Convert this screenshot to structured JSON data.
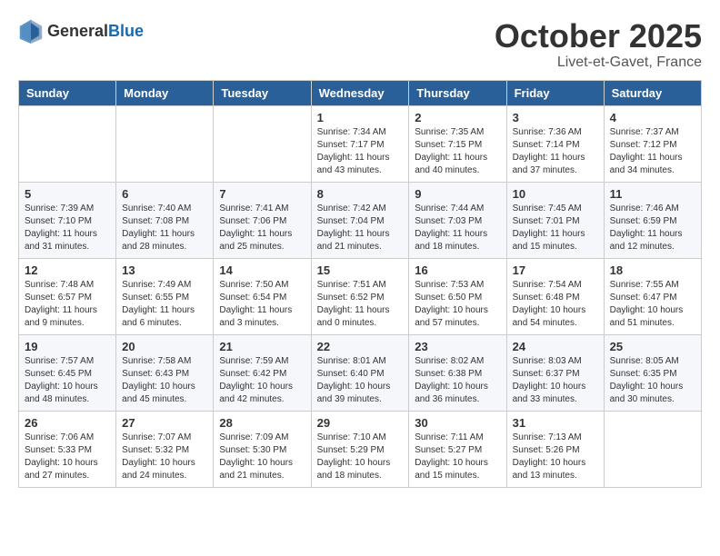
{
  "header": {
    "logo_general": "General",
    "logo_blue": "Blue",
    "title": "October 2025",
    "subtitle": "Livet-et-Gavet, France"
  },
  "weekdays": [
    "Sunday",
    "Monday",
    "Tuesday",
    "Wednesday",
    "Thursday",
    "Friday",
    "Saturday"
  ],
  "weeks": [
    [
      {
        "day": "",
        "info": ""
      },
      {
        "day": "",
        "info": ""
      },
      {
        "day": "",
        "info": ""
      },
      {
        "day": "1",
        "info": "Sunrise: 7:34 AM\nSunset: 7:17 PM\nDaylight: 11 hours\nand 43 minutes."
      },
      {
        "day": "2",
        "info": "Sunrise: 7:35 AM\nSunset: 7:15 PM\nDaylight: 11 hours\nand 40 minutes."
      },
      {
        "day": "3",
        "info": "Sunrise: 7:36 AM\nSunset: 7:14 PM\nDaylight: 11 hours\nand 37 minutes."
      },
      {
        "day": "4",
        "info": "Sunrise: 7:37 AM\nSunset: 7:12 PM\nDaylight: 11 hours\nand 34 minutes."
      }
    ],
    [
      {
        "day": "5",
        "info": "Sunrise: 7:39 AM\nSunset: 7:10 PM\nDaylight: 11 hours\nand 31 minutes."
      },
      {
        "day": "6",
        "info": "Sunrise: 7:40 AM\nSunset: 7:08 PM\nDaylight: 11 hours\nand 28 minutes."
      },
      {
        "day": "7",
        "info": "Sunrise: 7:41 AM\nSunset: 7:06 PM\nDaylight: 11 hours\nand 25 minutes."
      },
      {
        "day": "8",
        "info": "Sunrise: 7:42 AM\nSunset: 7:04 PM\nDaylight: 11 hours\nand 21 minutes."
      },
      {
        "day": "9",
        "info": "Sunrise: 7:44 AM\nSunset: 7:03 PM\nDaylight: 11 hours\nand 18 minutes."
      },
      {
        "day": "10",
        "info": "Sunrise: 7:45 AM\nSunset: 7:01 PM\nDaylight: 11 hours\nand 15 minutes."
      },
      {
        "day": "11",
        "info": "Sunrise: 7:46 AM\nSunset: 6:59 PM\nDaylight: 11 hours\nand 12 minutes."
      }
    ],
    [
      {
        "day": "12",
        "info": "Sunrise: 7:48 AM\nSunset: 6:57 PM\nDaylight: 11 hours\nand 9 minutes."
      },
      {
        "day": "13",
        "info": "Sunrise: 7:49 AM\nSunset: 6:55 PM\nDaylight: 11 hours\nand 6 minutes."
      },
      {
        "day": "14",
        "info": "Sunrise: 7:50 AM\nSunset: 6:54 PM\nDaylight: 11 hours\nand 3 minutes."
      },
      {
        "day": "15",
        "info": "Sunrise: 7:51 AM\nSunset: 6:52 PM\nDaylight: 11 hours\nand 0 minutes."
      },
      {
        "day": "16",
        "info": "Sunrise: 7:53 AM\nSunset: 6:50 PM\nDaylight: 10 hours\nand 57 minutes."
      },
      {
        "day": "17",
        "info": "Sunrise: 7:54 AM\nSunset: 6:48 PM\nDaylight: 10 hours\nand 54 minutes."
      },
      {
        "day": "18",
        "info": "Sunrise: 7:55 AM\nSunset: 6:47 PM\nDaylight: 10 hours\nand 51 minutes."
      }
    ],
    [
      {
        "day": "19",
        "info": "Sunrise: 7:57 AM\nSunset: 6:45 PM\nDaylight: 10 hours\nand 48 minutes."
      },
      {
        "day": "20",
        "info": "Sunrise: 7:58 AM\nSunset: 6:43 PM\nDaylight: 10 hours\nand 45 minutes."
      },
      {
        "day": "21",
        "info": "Sunrise: 7:59 AM\nSunset: 6:42 PM\nDaylight: 10 hours\nand 42 minutes."
      },
      {
        "day": "22",
        "info": "Sunrise: 8:01 AM\nSunset: 6:40 PM\nDaylight: 10 hours\nand 39 minutes."
      },
      {
        "day": "23",
        "info": "Sunrise: 8:02 AM\nSunset: 6:38 PM\nDaylight: 10 hours\nand 36 minutes."
      },
      {
        "day": "24",
        "info": "Sunrise: 8:03 AM\nSunset: 6:37 PM\nDaylight: 10 hours\nand 33 minutes."
      },
      {
        "day": "25",
        "info": "Sunrise: 8:05 AM\nSunset: 6:35 PM\nDaylight: 10 hours\nand 30 minutes."
      }
    ],
    [
      {
        "day": "26",
        "info": "Sunrise: 7:06 AM\nSunset: 5:33 PM\nDaylight: 10 hours\nand 27 minutes."
      },
      {
        "day": "27",
        "info": "Sunrise: 7:07 AM\nSunset: 5:32 PM\nDaylight: 10 hours\nand 24 minutes."
      },
      {
        "day": "28",
        "info": "Sunrise: 7:09 AM\nSunset: 5:30 PM\nDaylight: 10 hours\nand 21 minutes."
      },
      {
        "day": "29",
        "info": "Sunrise: 7:10 AM\nSunset: 5:29 PM\nDaylight: 10 hours\nand 18 minutes."
      },
      {
        "day": "30",
        "info": "Sunrise: 7:11 AM\nSunset: 5:27 PM\nDaylight: 10 hours\nand 15 minutes."
      },
      {
        "day": "31",
        "info": "Sunrise: 7:13 AM\nSunset: 5:26 PM\nDaylight: 10 hours\nand 13 minutes."
      },
      {
        "day": "",
        "info": ""
      }
    ]
  ]
}
